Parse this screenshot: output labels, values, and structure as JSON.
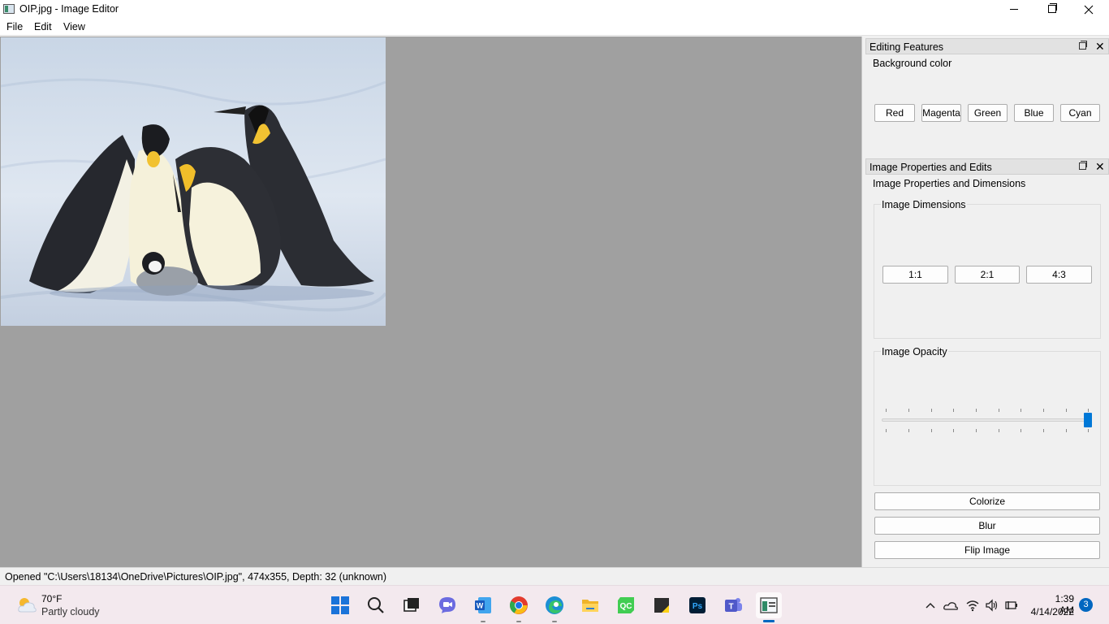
{
  "window": {
    "title": "OIP.jpg - Image Editor"
  },
  "menu": {
    "items": [
      {
        "label": "File"
      },
      {
        "label": "Edit"
      },
      {
        "label": "View"
      }
    ]
  },
  "editing_features": {
    "title": "Editing Features",
    "group_label": "Background color",
    "buttons": [
      {
        "label": "Red"
      },
      {
        "label": "Magenta"
      },
      {
        "label": "Green"
      },
      {
        "label": "Blue"
      },
      {
        "label": "Cyan"
      }
    ]
  },
  "image_props": {
    "title": "Image Properties and Edits",
    "group_label": "Image Properties and Dimensions",
    "dimensions": {
      "label": "Image Dimensions",
      "buttons": [
        {
          "label": "1:1"
        },
        {
          "label": "2:1"
        },
        {
          "label": "4:3"
        }
      ]
    },
    "opacity": {
      "label": "Image Opacity",
      "value_fraction": 1.0
    },
    "actions": [
      {
        "label": "Colorize"
      },
      {
        "label": "Blur"
      },
      {
        "label": "Flip Image"
      }
    ]
  },
  "status": {
    "text": "Opened \"C:\\Users\\18134\\OneDrive\\Pictures\\OIP.jpg\", 474x355, Depth: 32 (unknown)"
  },
  "taskbar": {
    "weather_temp": "70°F",
    "weather_desc": "Partly cloudy",
    "apps": [
      {
        "name": "start-icon"
      },
      {
        "name": "search-icon"
      },
      {
        "name": "task-view-icon"
      },
      {
        "name": "chat-icon"
      },
      {
        "name": "word-icon"
      },
      {
        "name": "chrome-icon"
      },
      {
        "name": "edge-icon"
      },
      {
        "name": "file-explorer-icon"
      },
      {
        "name": "qt-creator-icon"
      },
      {
        "name": "sticky-notes-icon"
      },
      {
        "name": "photoshop-icon"
      },
      {
        "name": "teams-icon"
      },
      {
        "name": "image-editor-icon"
      }
    ],
    "clock_time": "1:39 AM",
    "clock_date": "4/14/2022",
    "notification_count": "3"
  },
  "colors": {
    "canvas_bg": "#a0a0a0",
    "accent": "#0078d7",
    "taskbar_bg": "#f3e9ee"
  }
}
